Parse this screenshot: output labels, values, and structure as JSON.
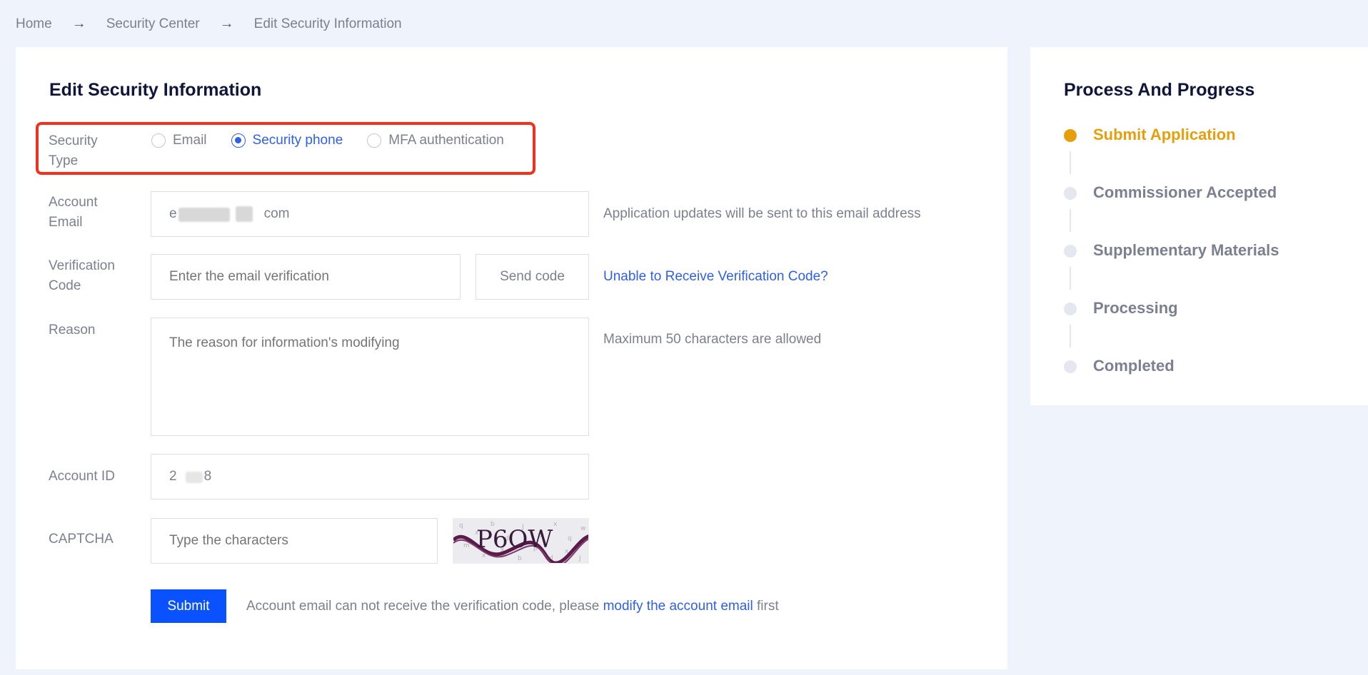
{
  "breadcrumb": {
    "home": "Home",
    "security_center": "Security Center",
    "current": "Edit Security Information",
    "separator": "→"
  },
  "form": {
    "title": "Edit Security Information",
    "security_type": {
      "label": "Security Type",
      "options": [
        "Email",
        "Security phone",
        "MFA authentication"
      ],
      "selected": "Security phone"
    },
    "account_email": {
      "label": "Account Email",
      "value_start": "e",
      "value_end": "com",
      "hint": "Application updates will be sent to this email address"
    },
    "verification_code": {
      "label": "Verification Code",
      "placeholder": "Enter the email verification",
      "send_button": "Send code",
      "help_link": "Unable to Receive Verification Code?"
    },
    "reason": {
      "label": "Reason",
      "placeholder": "The reason for information's modifying",
      "hint": "Maximum 50 characters are allowed"
    },
    "account_id": {
      "label": "Account ID",
      "value_start": "2",
      "value_end": "8"
    },
    "captcha": {
      "label": "CAPTCHA",
      "placeholder": "Type the characters",
      "image_text": "P6OW"
    },
    "submit_button": "Submit",
    "footer_note": {
      "before": "Account email can not receive the verification code, please",
      "link": "modify the account email",
      "after": "first"
    }
  },
  "progress": {
    "title": "Process And Progress",
    "steps": [
      {
        "label": "Submit Application",
        "active": true
      },
      {
        "label": "Commissioner Accepted",
        "active": false
      },
      {
        "label": "Supplementary Materials",
        "active": false
      },
      {
        "label": "Processing",
        "active": false
      },
      {
        "label": "Completed",
        "active": false
      }
    ]
  },
  "colors": {
    "background": "#eff3fb",
    "primary": "#0a52ff",
    "link": "#2f5fe8",
    "active_step": "#e69f0c",
    "highlight": "#f2311d"
  }
}
